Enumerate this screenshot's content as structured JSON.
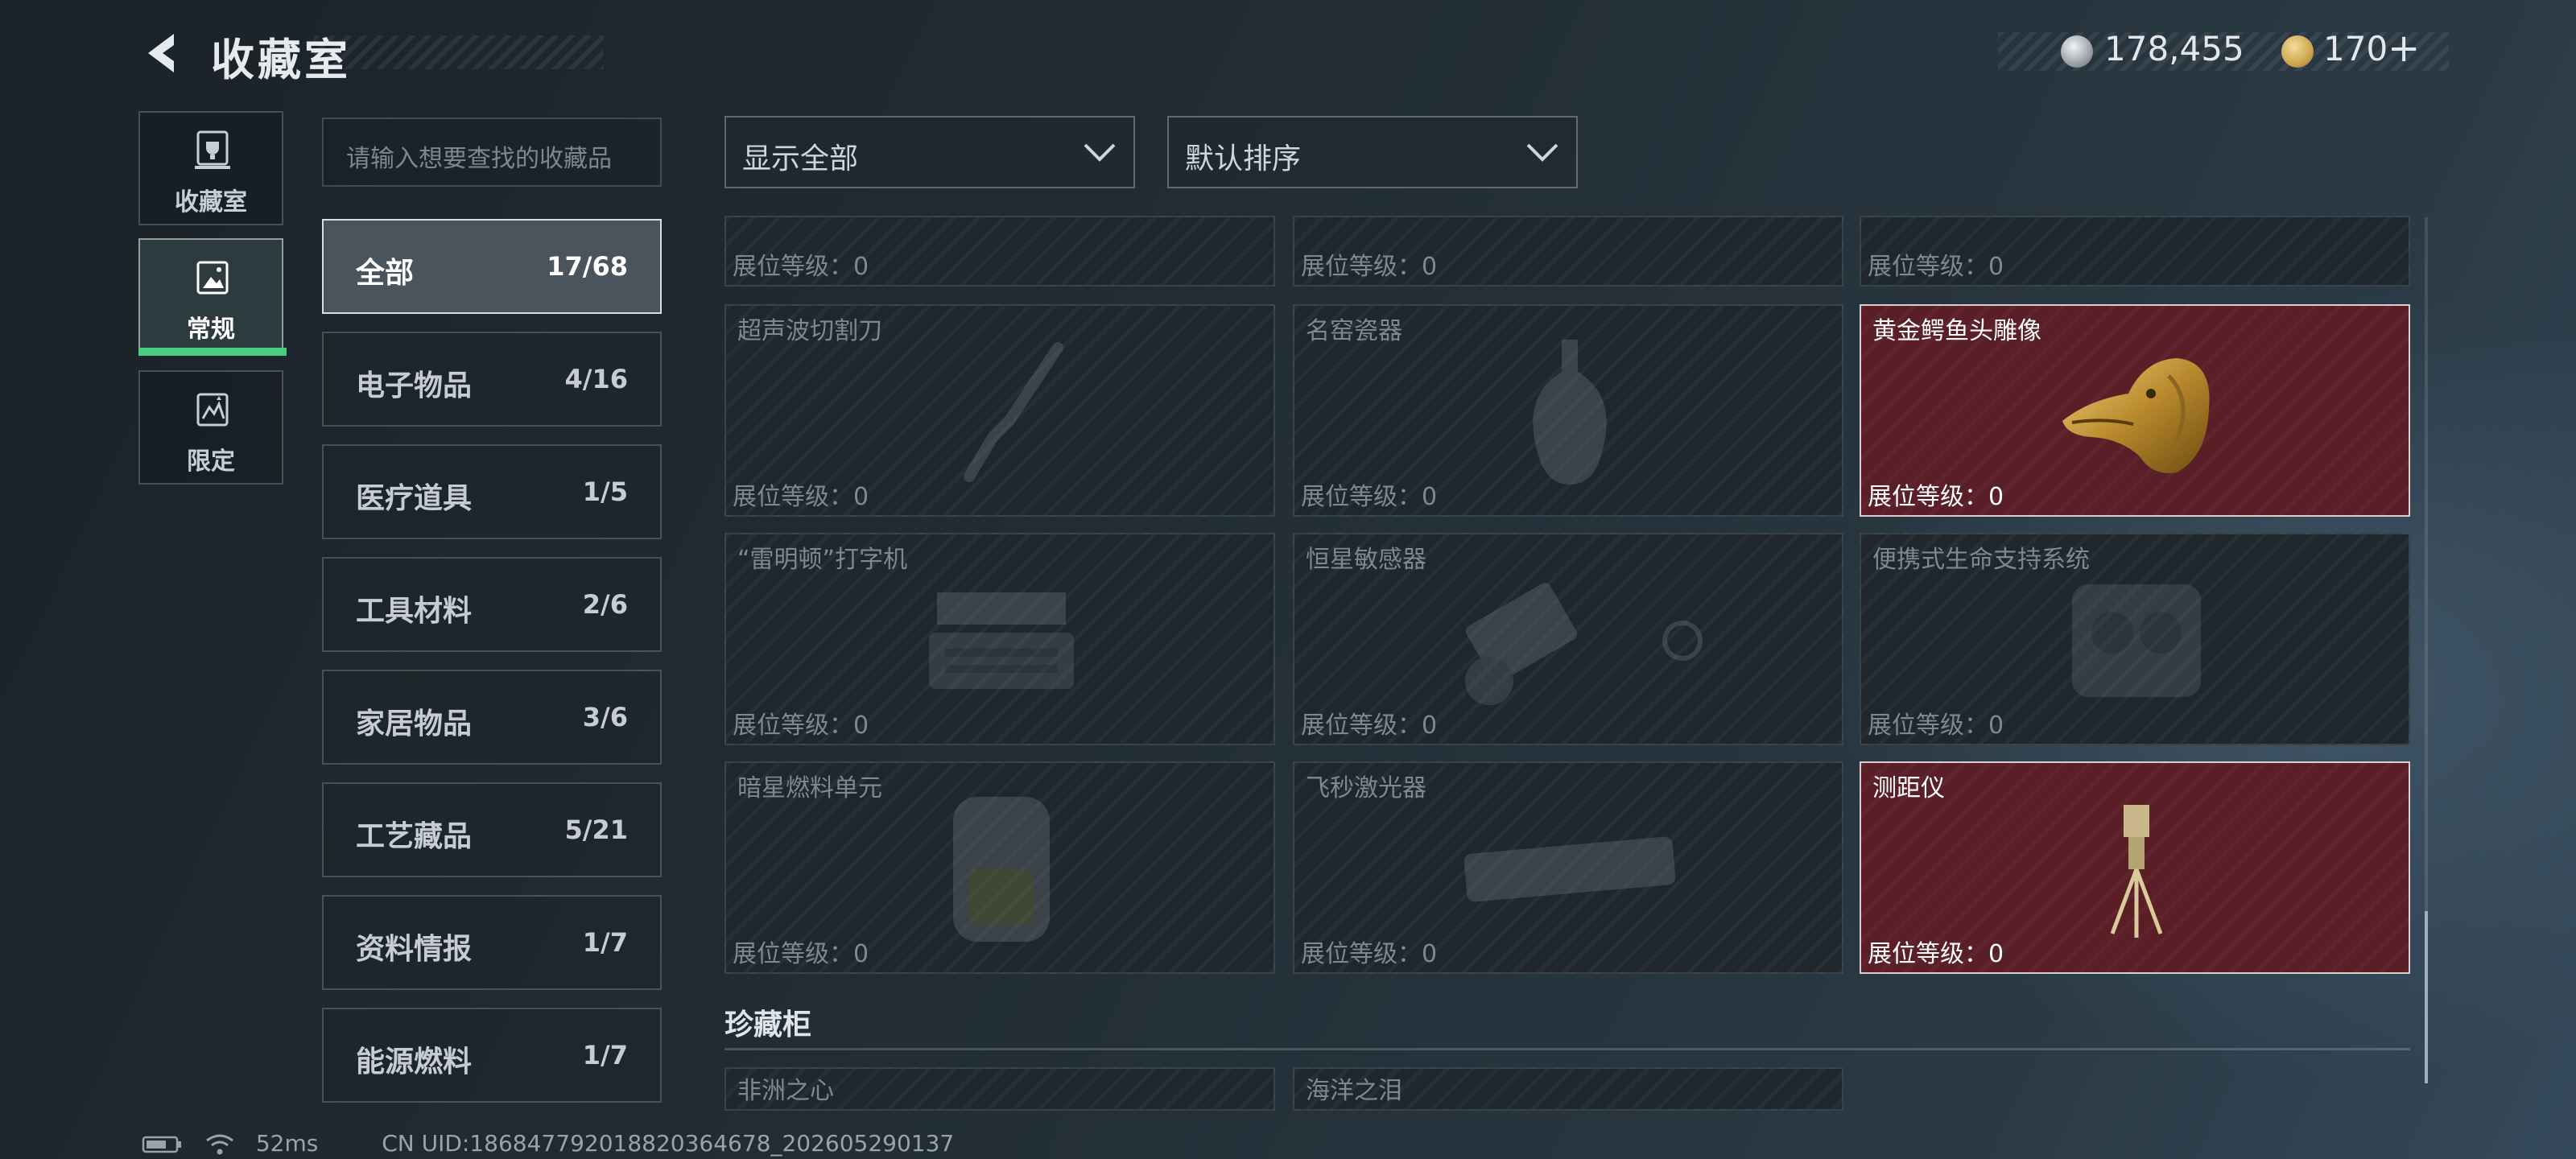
{
  "header": {
    "title": "收藏室",
    "back_icon": "back-arrow-icon"
  },
  "currency": [
    {
      "icon": "silver-coin-icon",
      "color": "#c9cdd1",
      "value": "178,455"
    },
    {
      "icon": "gold-triangle-coin-icon",
      "color": "#c9a24a",
      "value": "170",
      "suffix": "+"
    }
  ],
  "nav": [
    {
      "label": "收藏室",
      "icon": "trophy-cabinet-icon",
      "active": false
    },
    {
      "label": "常规",
      "icon": "picture-frame-icon",
      "active": true
    },
    {
      "label": "限定",
      "icon": "limited-frame-icon",
      "active": false
    }
  ],
  "search": {
    "placeholder": "请输入想要查找的收藏品"
  },
  "categories": [
    {
      "name": "全部",
      "count": "17/68",
      "active": true
    },
    {
      "name": "电子物品",
      "count": "4/16"
    },
    {
      "name": "医疗道具",
      "count": "1/5"
    },
    {
      "name": "工具材料",
      "count": "2/6"
    },
    {
      "name": "家居物品",
      "count": "3/6"
    },
    {
      "name": "工艺藏品",
      "count": "5/21"
    },
    {
      "name": "资料情报",
      "count": "1/7"
    },
    {
      "name": "能源燃料",
      "count": "1/7"
    }
  ],
  "filters": {
    "show": {
      "value": "显示全部",
      "icon": "chevron-down-icon"
    },
    "sort": {
      "value": "默认排序",
      "icon": "chevron-down-icon"
    }
  },
  "level_label": "展位等级：",
  "items": [
    {
      "name": "",
      "level": "0",
      "owned": false
    },
    {
      "name": "",
      "level": "0",
      "owned": false
    },
    {
      "name": "",
      "level": "0",
      "owned": false
    },
    {
      "name": "超声波切割刀",
      "level": "0",
      "owned": false,
      "icon": "ultrasonic-cutter-icon"
    },
    {
      "name": "名窑瓷器",
      "level": "0",
      "owned": false,
      "icon": "porcelain-vase-icon"
    },
    {
      "name": "黄金鳄鱼头雕像",
      "level": "0",
      "owned": true,
      "icon": "golden-crocodile-head-icon"
    },
    {
      "name": "“雷明顿”打字机",
      "level": "0",
      "owned": false,
      "icon": "typewriter-icon"
    },
    {
      "name": "恒星敏感器",
      "level": "0",
      "owned": false,
      "icon": "star-sensor-icon"
    },
    {
      "name": "便携式生命支持系统",
      "level": "0",
      "owned": false,
      "icon": "life-support-icon"
    },
    {
      "name": "暗星燃料单元",
      "level": "0",
      "owned": false,
      "icon": "fuel-cell-icon"
    },
    {
      "name": "飞秒激光器",
      "level": "0",
      "owned": false,
      "icon": "laser-icon"
    },
    {
      "name": "测距仪",
      "level": "0",
      "owned": true,
      "icon": "rangefinder-tripod-icon"
    }
  ],
  "section": {
    "title": "珍藏柜"
  },
  "treasures": [
    {
      "name": "非洲之心"
    },
    {
      "name": "海洋之泪"
    }
  ],
  "status": {
    "battery_icon": "battery-icon",
    "wifi_icon": "wifi-icon",
    "ping": "52ms",
    "uid": "CN UID:186847792018820364678_202605290137"
  }
}
